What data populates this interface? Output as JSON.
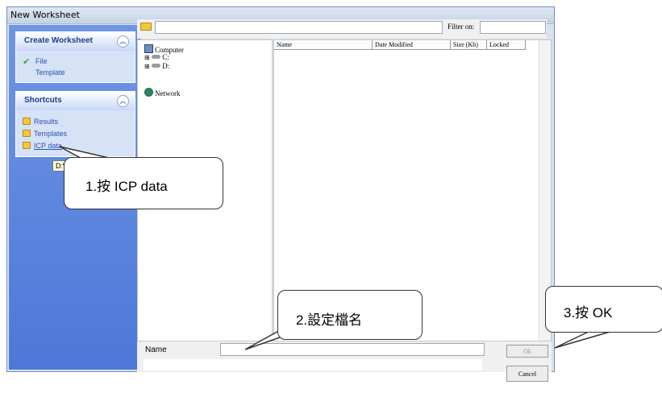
{
  "window": {
    "title": "New Worksheet"
  },
  "sidebar": {
    "create_panel": {
      "title": "Create Worksheet",
      "items": [
        "File",
        "Template"
      ]
    },
    "shortcuts_panel": {
      "title": "Shortcuts",
      "items": [
        "Results",
        "Templates",
        "ICP data"
      ]
    },
    "tooltip": "D:\\ICP"
  },
  "toolbar": {
    "filter_label": "Filter on:"
  },
  "tree": {
    "items": [
      "Computer",
      "C:",
      "D:",
      "Network"
    ]
  },
  "filelist": {
    "columns": [
      "Name",
      "Date Modified",
      "Size (Kb)",
      "Locked"
    ]
  },
  "bottom": {
    "name_label": "Name",
    "ok_label": "Ok",
    "cancel_label": "Cancel"
  },
  "callouts": {
    "step1": "1.按 ICP data",
    "step2": "2.設定檔名",
    "step3": "3.按 OK"
  },
  "colors": {
    "sidebar": "#5a82dd",
    "link": "#2553b0"
  }
}
